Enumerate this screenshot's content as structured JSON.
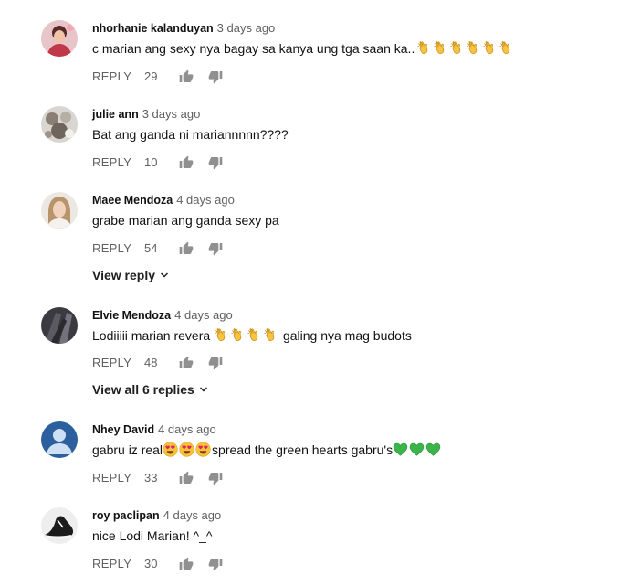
{
  "comments": [
    {
      "author": "nhorhanie kalanduyan",
      "time": "3 days ago",
      "text": "c marian ang sexy nya bagay sa kanya ung tga saan ka..",
      "emoji": "clapping-hands-icon",
      "emoji_count": 6,
      "reply_label": "REPLY",
      "likes": "29"
    },
    {
      "author": "julie ann",
      "time": "3 days ago",
      "text": "Bat ang ganda ni mariannnnn????",
      "reply_label": "REPLY",
      "likes": "10"
    },
    {
      "author": "Maee Mendoza",
      "time": "4 days ago",
      "text": "grabe marian ang ganda sexy pa",
      "reply_label": "REPLY",
      "likes": "54",
      "view_replies": "View reply"
    },
    {
      "author": "Elvie Mendoza",
      "time": "4 days ago",
      "text_before": "Lodiiiii marian revera",
      "emoji": "clapping-hands-icon",
      "emoji_count": 4,
      "text_after": "galing nya mag budots",
      "reply_label": "REPLY",
      "likes": "48",
      "view_replies": "View all 6 replies"
    },
    {
      "author": "Nhey David",
      "time": "4 days ago",
      "text_before": "gabru iz real",
      "emoji_a": "heart-eyes-icon",
      "emoji_a_count": 3,
      "text_mid": "spread the green hearts gabru's",
      "emoji_b": "green-heart-icon",
      "emoji_b_count": 3,
      "reply_label": "REPLY",
      "likes": "33"
    },
    {
      "author": "roy paclipan",
      "time": "4 days ago",
      "text": "nice Lodi Marian! ^_^",
      "reply_label": "REPLY",
      "likes": "30"
    }
  ],
  "colors": {
    "text": "#111111",
    "secondary": "#606060",
    "avatar_default": "#2c5f9e",
    "green_heart": "#3bb54a",
    "clap": "#f6c343"
  }
}
